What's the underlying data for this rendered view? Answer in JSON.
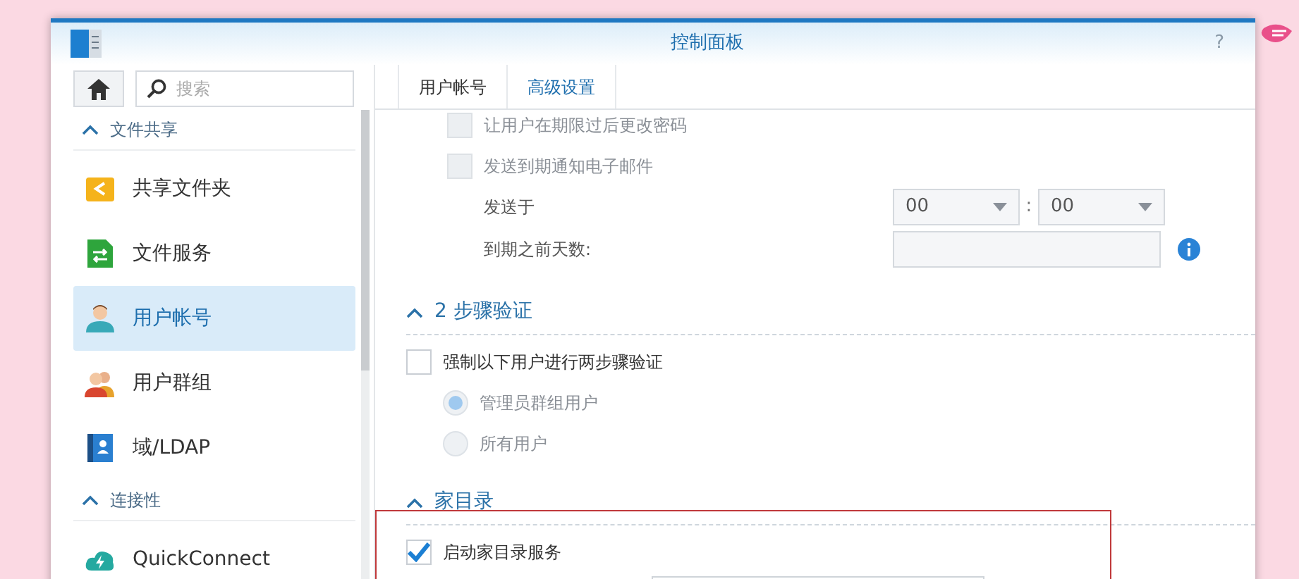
{
  "window": {
    "title": "控制面板",
    "help": "?"
  },
  "sidebar": {
    "search": {
      "placeholder": "搜索"
    },
    "sections": [
      {
        "title": "文件共享",
        "expanded": true,
        "items": [
          {
            "label": "共享文件夹",
            "kind": "folder",
            "selected": false
          },
          {
            "label": "文件服务",
            "kind": "file",
            "selected": false
          },
          {
            "label": "用户帐号",
            "kind": "user",
            "selected": true
          },
          {
            "label": "用户群组",
            "kind": "group",
            "selected": false
          },
          {
            "label": "域/LDAP",
            "kind": "book",
            "selected": false
          }
        ]
      },
      {
        "title": "连接性",
        "expanded": true,
        "items": [
          {
            "label": "QuickConnect",
            "kind": "cloud",
            "selected": false
          }
        ]
      }
    ]
  },
  "tabs": [
    {
      "label": "用户帐号",
      "selected": false
    },
    {
      "label": "高级设置",
      "selected": true
    }
  ],
  "content": {
    "sections": [
      {
        "rows": [
          {
            "kind": "checkbox",
            "label": "让用户在期限过后更改密码",
            "checked": false,
            "disabled": true
          },
          {
            "kind": "checkbox",
            "label": "发送到期通知电子邮件",
            "checked": false,
            "disabled": true,
            "children": [
              {
                "kind": "time",
                "label": "发送于",
                "hour": "00",
                "separator": ":",
                "minute": "00"
              },
              {
                "kind": "input",
                "label": "到期之前天数:",
                "info": true
              }
            ]
          }
        ]
      },
      {
        "title": "2 步骤验证",
        "expanded": true,
        "rows": [
          {
            "kind": "checkbox",
            "label": "强制以下用户进行两步骤验证",
            "checked": false,
            "disabled": false,
            "children": [
              {
                "kind": "radio",
                "label": "管理员群组用户",
                "selected": true,
                "disabled": true
              },
              {
                "kind": "radio",
                "label": "所有用户",
                "selected": false,
                "disabled": true
              }
            ]
          }
        ]
      },
      {
        "title": "家目录",
        "expanded": true,
        "highlighted": true,
        "rows": [
          {
            "kind": "checkbox",
            "label": "启动家目录服务",
            "checked": true,
            "disabled": false
          },
          {
            "kind": "field"
          }
        ]
      }
    ]
  }
}
